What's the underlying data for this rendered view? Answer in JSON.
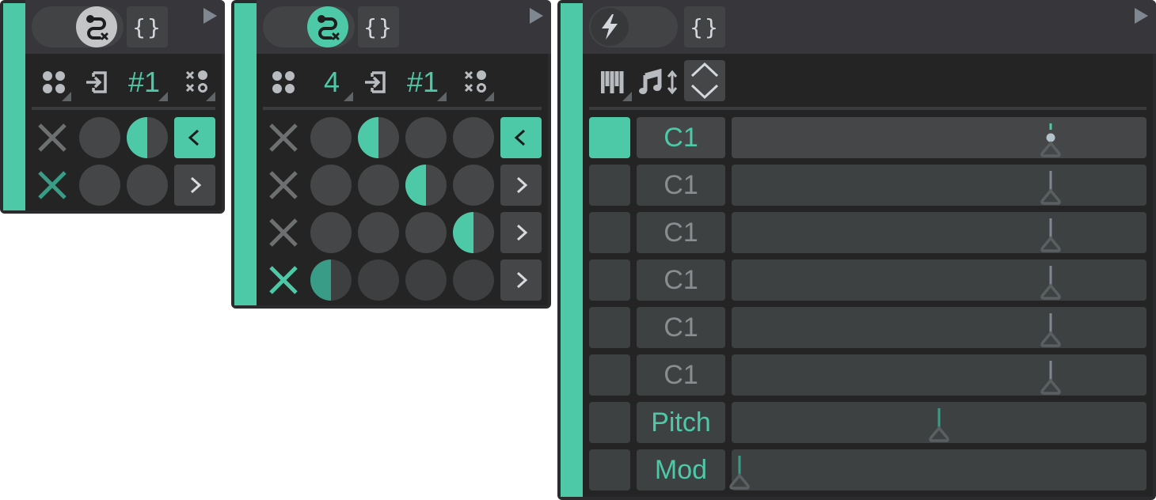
{
  "colors": {
    "accent": "#4dc9a7",
    "accent_dark": "#389c86",
    "panel_bg": "#242424",
    "header_bg": "#37373b",
    "button_bg": "#454647",
    "icon_gray": "#b8bcc0",
    "muted_text": "#8a8d8f"
  },
  "panels": [
    {
      "id": "panel-1",
      "header": {
        "toggle_icon": "route-x-icon",
        "toggle_state": "on-gray",
        "brace_label": "{}",
        "play_icon": "play-icon"
      },
      "toolbar": {
        "grid_icon": "four-dots-icon",
        "input_icon": "input-arrow-icon",
        "channel_label": "#1",
        "pattern_icon": "x-dot-pattern-icon"
      },
      "grid": {
        "columns": 2,
        "rows": [
          {
            "mute_active": false,
            "steps": [
              0,
              0.5
            ],
            "active_step": 1,
            "nav": "<",
            "nav_active": true
          },
          {
            "mute_active": true,
            "steps": [
              0,
              0
            ],
            "active_step": -1,
            "nav": ">",
            "nav_active": false
          }
        ]
      }
    },
    {
      "id": "panel-2",
      "header": {
        "toggle_icon": "route-x-icon",
        "toggle_state": "on-teal",
        "brace_label": "{}",
        "play_icon": "play-icon"
      },
      "toolbar": {
        "grid_icon": "four-dots-icon",
        "count_label": "4",
        "input_icon": "input-arrow-icon",
        "channel_label": "#1",
        "pattern_icon": "x-dot-pattern-icon"
      },
      "grid": {
        "columns": 4,
        "rows": [
          {
            "mute_active": false,
            "active_step": 1,
            "nav": "<",
            "nav_active": true
          },
          {
            "mute_active": false,
            "active_step": 2,
            "nav": ">",
            "nav_active": false
          },
          {
            "mute_active": false,
            "active_step": 3,
            "nav": ">",
            "nav_active": false
          },
          {
            "mute_active": true,
            "active_step": 0,
            "nav": ">",
            "nav_active": false
          }
        ]
      }
    },
    {
      "id": "panel-3",
      "header": {
        "toggle_icon": "lightning-icon",
        "toggle_state": "off",
        "brace_label": "{}",
        "play_icon": "play-icon"
      },
      "toolbar": {
        "keyboard_icon": "piano-keys-icon",
        "note_transpose_icon": "music-note-updown-icon",
        "expand_icon": "chevron-up-down-icon"
      },
      "rows": [
        {
          "gate": true,
          "label": "C1",
          "label_teal": true,
          "value": 0.78,
          "playhead": true
        },
        {
          "gate": false,
          "label": "C1",
          "label_teal": false,
          "value": 0.78
        },
        {
          "gate": false,
          "label": "C1",
          "label_teal": false,
          "value": 0.78
        },
        {
          "gate": false,
          "label": "C1",
          "label_teal": false,
          "value": 0.78
        },
        {
          "gate": false,
          "label": "C1",
          "label_teal": false,
          "value": 0.78
        },
        {
          "gate": false,
          "label": "C1",
          "label_teal": false,
          "value": 0.78
        },
        {
          "gate": false,
          "label": "Pitch",
          "label_teal": true,
          "value": 0.5,
          "teal_stem": true
        },
        {
          "gate": false,
          "label": "Mod",
          "label_teal": true,
          "value": 0.0,
          "teal_stem": true
        }
      ]
    }
  ]
}
